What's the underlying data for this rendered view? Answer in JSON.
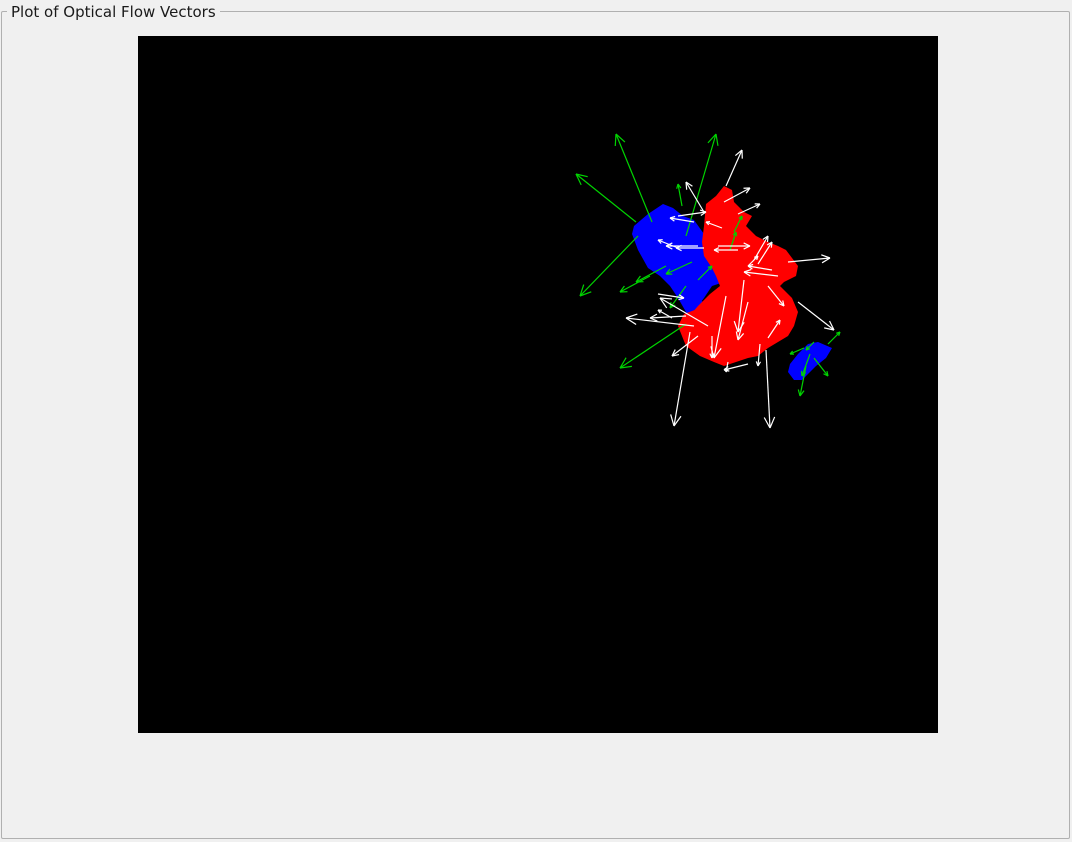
{
  "panel": {
    "title": "Plot of Optical Flow Vectors"
  },
  "colors": {
    "background": "#000000",
    "region_red": "#ff0000",
    "region_blue": "#0000ff",
    "vector_green": "#00d400",
    "vector_white": "#ffffff"
  }
}
